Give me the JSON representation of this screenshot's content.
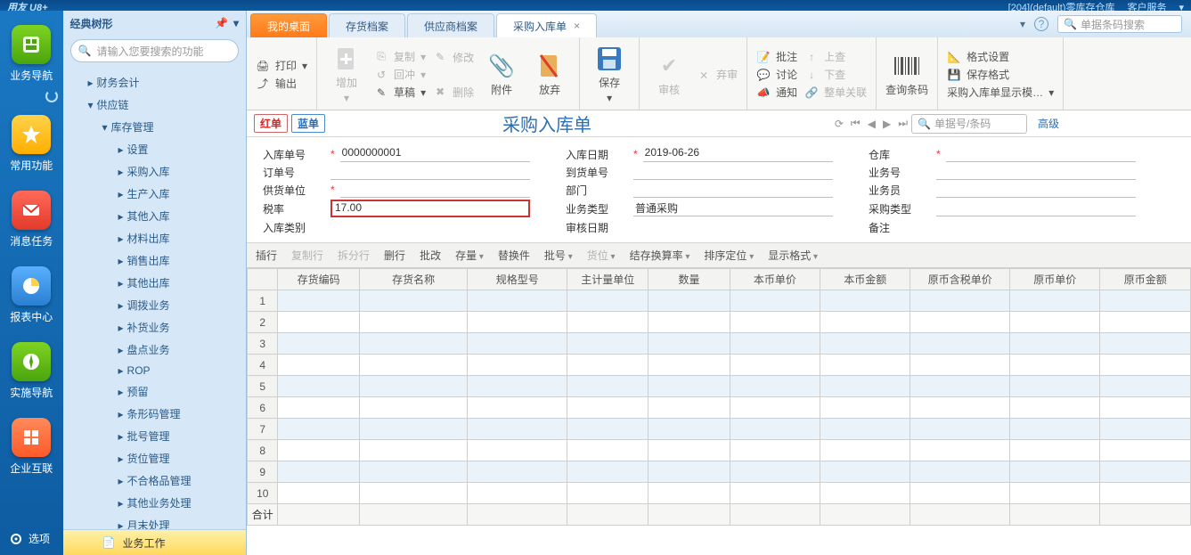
{
  "titlebar": {
    "left": "用友 U8+",
    "account": "[204](default)零库存仓库",
    "service": "客户服务"
  },
  "leftnav": {
    "b1": "业务导航",
    "b2": "常用功能",
    "b3": "消息任务",
    "b4": "报表中心",
    "b5": "实施导航",
    "b6": "企业互联",
    "options": "选项"
  },
  "tree": {
    "title": "经典树形",
    "search_ph": "请输入您要搜索的功能",
    "n_财务会计": "财务会计",
    "n_供应链": "供应链",
    "n_库存管理": "库存管理",
    "items": {
      "设置": "设置",
      "采购入库": "采购入库",
      "生产入库": "生产入库",
      "其他入库": "其他入库",
      "材料出库": "材料出库",
      "销售出库": "销售出库",
      "其他出库": "其他出库",
      "调拨业务": "调拨业务",
      "补货业务": "补货业务",
      "盘点业务": "盘点业务",
      "ROP": "ROP",
      "预留": "预留",
      "条形码管理": "条形码管理",
      "批号管理": "批号管理",
      "货位管理": "货位管理",
      "不合格品管理": "不合格品管理",
      "其他业务处理": "其他业务处理",
      "月末处理": "月末处理"
    },
    "foot_业务工作": "业务工作"
  },
  "tabs": {
    "t1": "我的桌面",
    "t2": "存货档案",
    "t3": "供应商档案",
    "t4": "采购入库单",
    "search_ph": "单据条码搜索"
  },
  "ribbon": {
    "打印": "打印",
    "输出": "输出",
    "增加": "增加",
    "复制": "复制",
    "回冲": "回冲",
    "草稿": "草稿",
    "修改": "修改",
    "删除": "删除",
    "附件": "附件",
    "放弃": "放弃",
    "保存": "保存",
    "审核": "审核",
    "弃审": "弃审",
    "批注": "批注",
    "讨论": "讨论",
    "通知": "通知",
    "上查": "上查",
    "下查": "下查",
    "整单关联": "整单关联",
    "查询条码": "查询条码",
    "格式设置": "格式设置",
    "保存格式": "保存格式",
    "显示模板": "采购入库单显示模…"
  },
  "doc": {
    "red": "红单",
    "blue": "蓝单",
    "title": "采购入库单",
    "search_ph": "单据号/条码",
    "adv": "高级",
    "f_入库单号_l": "入库单号",
    "f_入库单号_v": "0000000001",
    "f_入库日期_l": "入库日期",
    "f_入库日期_v": "2019-06-26",
    "f_仓库_l": "仓库",
    "f_订单号_l": "订单号",
    "f_到货单号_l": "到货单号",
    "f_业务号_l": "业务号",
    "f_供货单位_l": "供货单位",
    "f_部门_l": "部门",
    "f_业务员_l": "业务员",
    "f_税率_l": "税率",
    "f_税率_v": "17.00",
    "f_业务类型_l": "业务类型",
    "f_业务类型_v": "普通采购",
    "f_采购类型_l": "采购类型",
    "f_入库类别_l": "入库类别",
    "f_审核日期_l": "审核日期",
    "f_备注_l": "备注"
  },
  "gridbar": {
    "插行": "插行",
    "复制行": "复制行",
    "拆分行": "拆分行",
    "删行": "删行",
    "批改": "批改",
    "存量": "存量",
    "替换件": "替换件",
    "批号": "批号",
    "货位": "货位",
    "结存换算率": "结存换算率",
    "排序定位": "排序定位",
    "显示格式": "显示格式"
  },
  "grid": {
    "cols": {
      "c1": "存货编码",
      "c2": "存货名称",
      "c3": "规格型号",
      "c4": "主计量单位",
      "c5": "数量",
      "c6": "本币单价",
      "c7": "本币金额",
      "c8": "原币含税单价",
      "c9": "原币单价",
      "c10": "原币金额"
    },
    "rows": [
      "1",
      "2",
      "3",
      "4",
      "5",
      "6",
      "7",
      "8",
      "9",
      "10"
    ],
    "sum": "合计"
  }
}
